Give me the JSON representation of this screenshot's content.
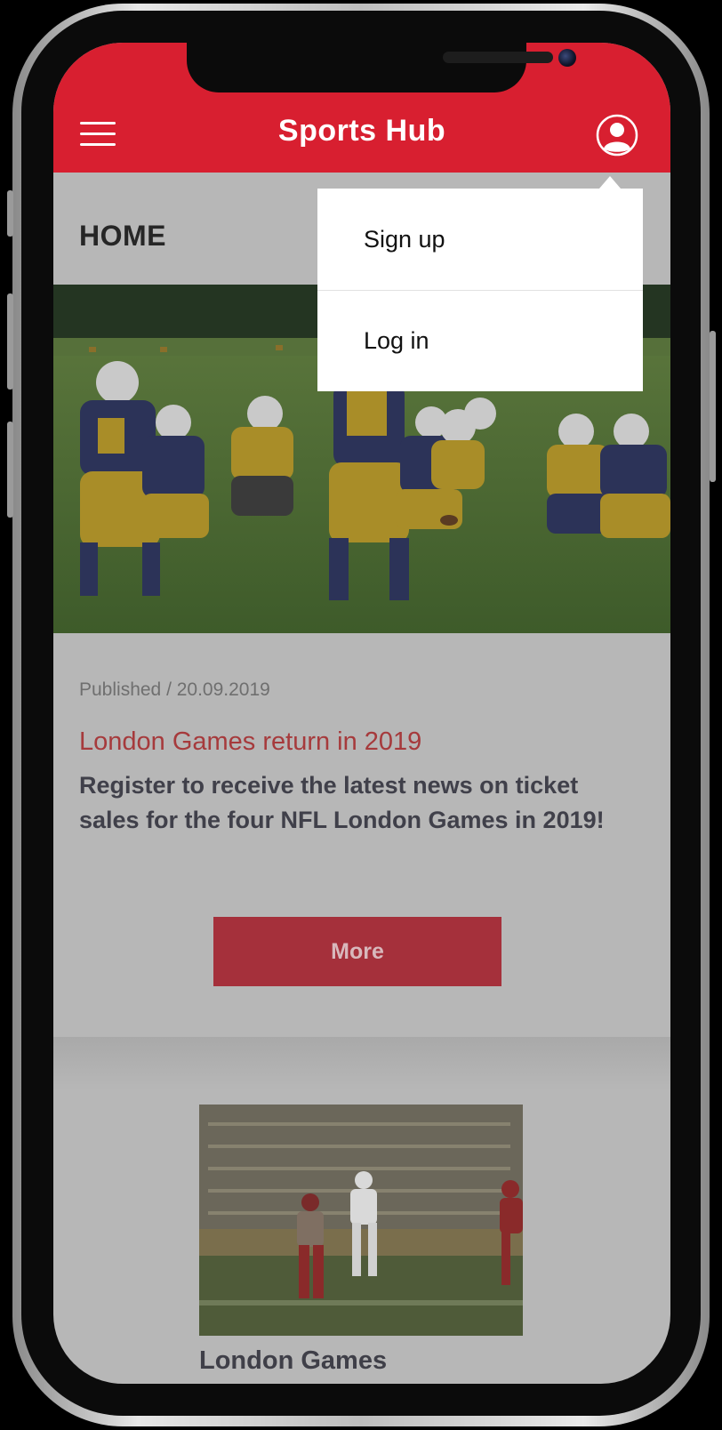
{
  "app": {
    "title": "Sports Hub"
  },
  "header": {
    "menu_icon": "hamburger-menu-icon",
    "profile_icon": "user-profile-icon",
    "brand_color": "#d81f30"
  },
  "page": {
    "title": "HOME"
  },
  "user_menu": {
    "items": [
      {
        "label": "Sign up"
      },
      {
        "label": "Log in"
      }
    ]
  },
  "article": {
    "published": "Published / 20.09.2019",
    "headline": "London Games return in 2019",
    "summary": "Register to receive the latest news on ticket sales for the four NFL London Games in 2019!",
    "button_label": "More",
    "headline_color": "#a63a3c",
    "button_color": "#a5303b"
  },
  "card": {
    "title": "London Games"
  }
}
